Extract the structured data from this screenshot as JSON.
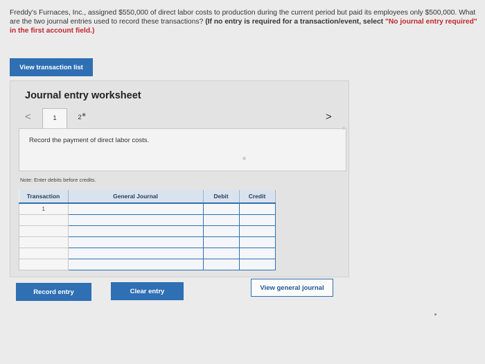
{
  "question": {
    "text": "Freddy's Furnaces, Inc., assigned $550,000 of direct labor costs to production during the current period but paid its employees only $500,000. What are the two journal entries used to record these transactions? ",
    "instruction_prefix": "(If no entry is required for a transaction/event, select ",
    "instruction_quote": "\"No journal entry required\" in the first account field.)"
  },
  "buttons": {
    "view_transaction_list": "View transaction list",
    "record_entry": "Record entry",
    "clear_entry": "Clear entry",
    "view_general_journal": "View general journal"
  },
  "worksheet": {
    "title": "Journal entry worksheet",
    "tabs": [
      "1",
      "2"
    ],
    "prev_arrow": "<",
    "next_arrow": ">",
    "instruction": "Record the payment of direct labor costs.",
    "note": "Note: Enter debits before credits."
  },
  "journal": {
    "headers": [
      "Transaction",
      "General Journal",
      "Debit",
      "Credit"
    ],
    "rows": [
      {
        "transaction": "1",
        "account": "",
        "debit": "",
        "credit": ""
      },
      {
        "transaction": "",
        "account": "",
        "debit": "",
        "credit": ""
      },
      {
        "transaction": "",
        "account": "",
        "debit": "",
        "credit": ""
      },
      {
        "transaction": "",
        "account": "",
        "debit": "",
        "credit": ""
      },
      {
        "transaction": "",
        "account": "",
        "debit": "",
        "credit": ""
      },
      {
        "transaction": "",
        "account": "",
        "debit": "",
        "credit": ""
      }
    ]
  },
  "colors": {
    "accent": "#2f6fb3",
    "background": "#ebebeb",
    "header_bg": "#d8e3ee",
    "warning_red": "#c0272d"
  }
}
